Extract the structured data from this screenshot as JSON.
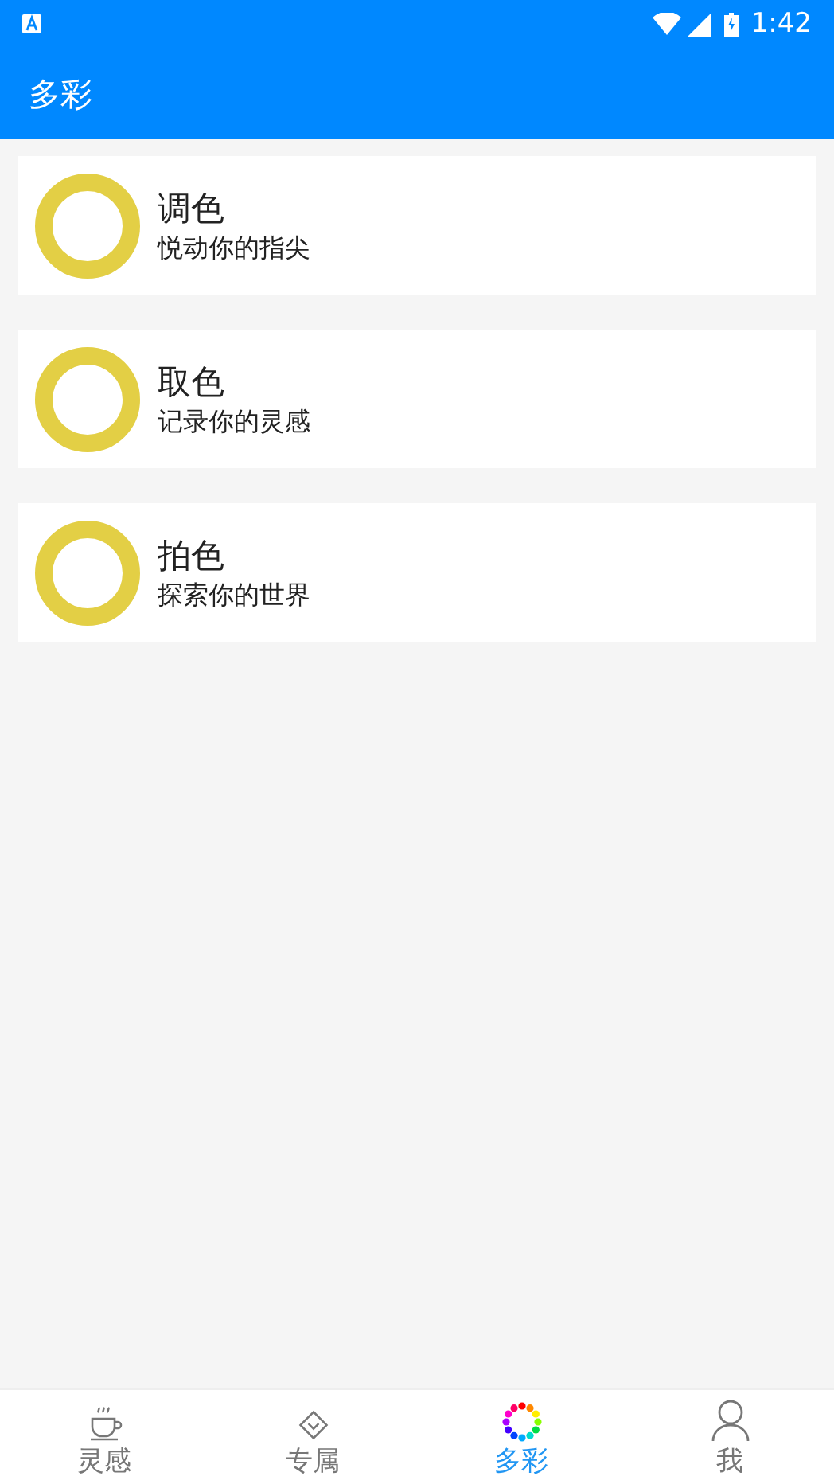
{
  "status_bar": {
    "time": "1:42"
  },
  "header": {
    "title": "多彩"
  },
  "cards": [
    {
      "title": "调色",
      "subtitle": "悦动你的指尖"
    },
    {
      "title": "取色",
      "subtitle": "记录你的灵感"
    },
    {
      "title": "拍色",
      "subtitle": "探索你的世界"
    }
  ],
  "bottom_nav": [
    {
      "kind": "cup",
      "label": "灵感",
      "selected": false
    },
    {
      "kind": "diamond",
      "label": "专属",
      "selected": false
    },
    {
      "kind": "palette",
      "label": "多彩",
      "selected": true
    },
    {
      "kind": "person",
      "label": "我",
      "selected": false
    }
  ]
}
